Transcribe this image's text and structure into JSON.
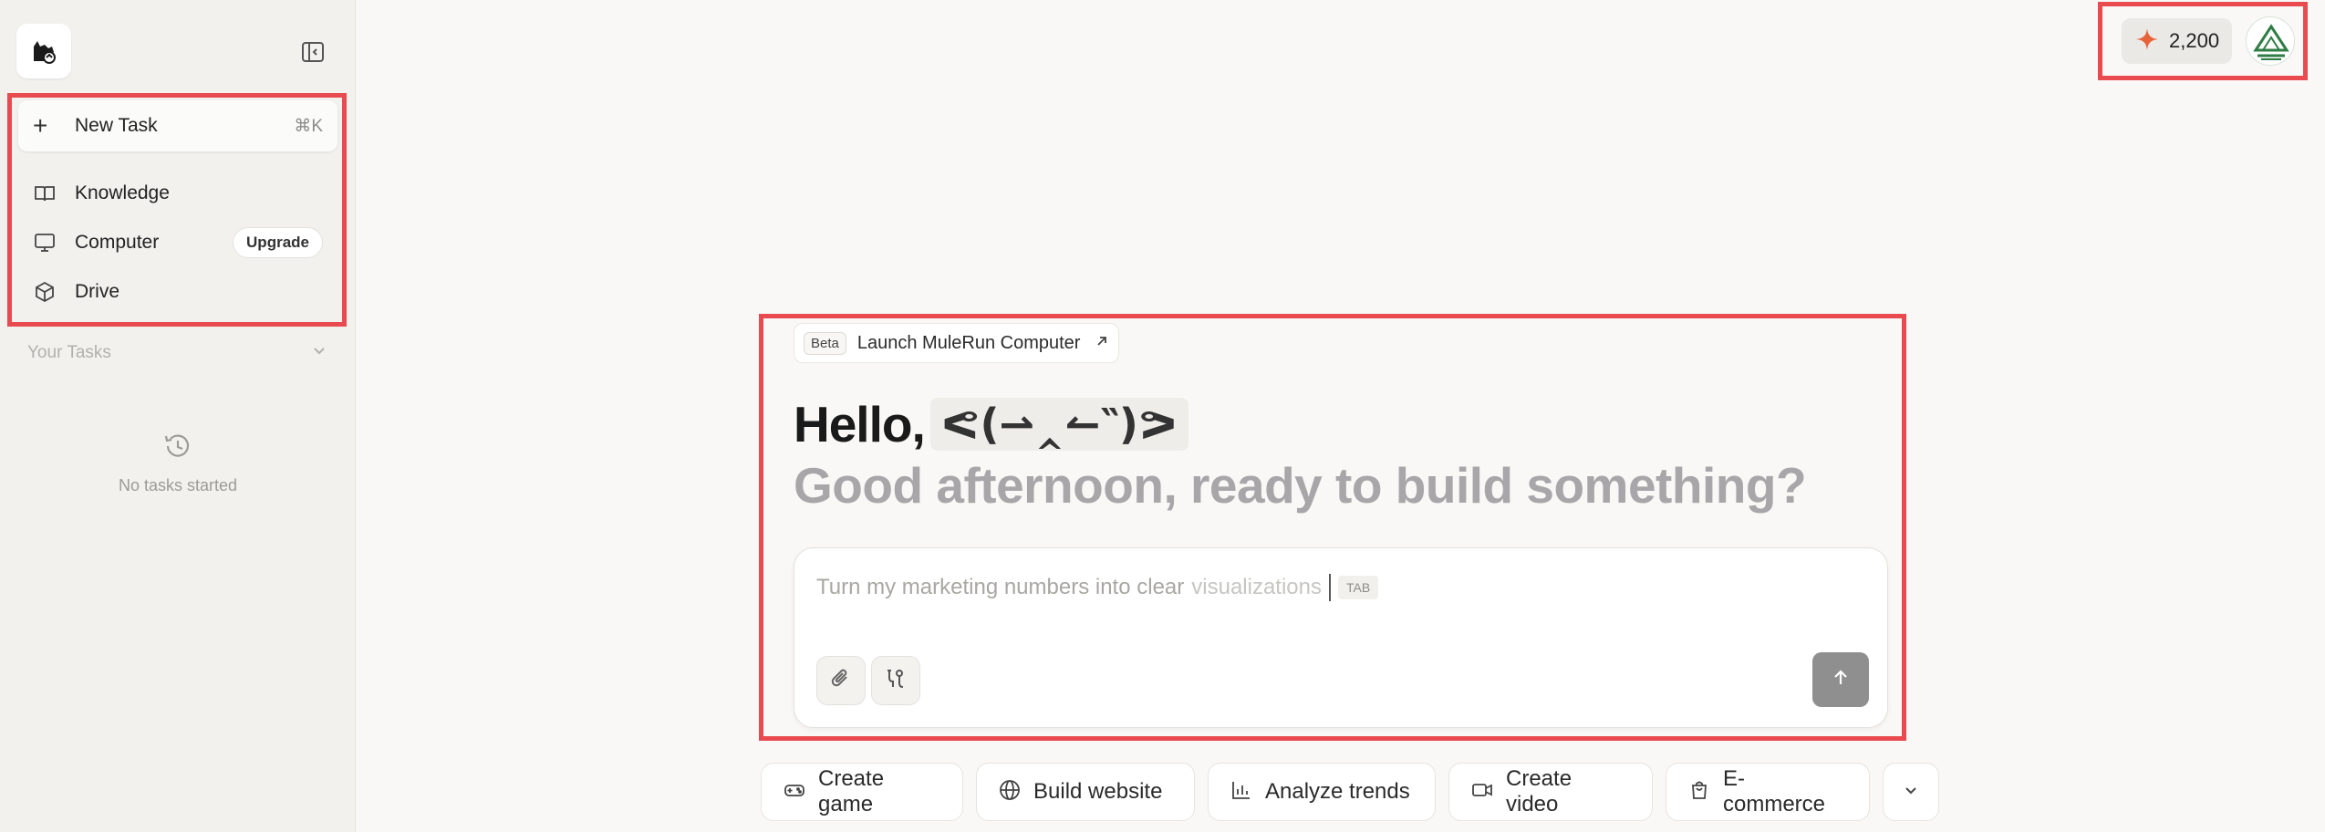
{
  "sidebar": {
    "logo_icon": "mule-logo-icon",
    "collapse_icon": "sidebar-collapse-icon",
    "new_task": {
      "label": "New Task",
      "shortcut": "⌘K"
    },
    "items": [
      {
        "label": "Knowledge",
        "icon": "book-icon"
      },
      {
        "label": "Computer",
        "icon": "monitor-icon",
        "badge": "Upgrade"
      },
      {
        "label": "Drive",
        "icon": "box-icon"
      }
    ],
    "your_tasks_label": "Your Tasks",
    "empty_state": "No tasks started"
  },
  "header": {
    "credits": "2,200",
    "credits_icon": "sparkle-icon",
    "accent": "#e8633a"
  },
  "main": {
    "beta_tag": "Beta",
    "launch_label": "Launch MuleRun Computer",
    "hello": "Hello,",
    "user_name": "ᕙ(⇀‸↼‶)ᕗ",
    "greeting": "Good afternoon, ready to build something?",
    "input": {
      "placeholder_main": "Turn my marketing numbers into clear",
      "placeholder_faded": "visualizations",
      "tab_hint": "TAB"
    },
    "chips": [
      {
        "label": "Create game",
        "icon": "gamepad-icon"
      },
      {
        "label": "Build website",
        "icon": "globe-icon"
      },
      {
        "label": "Analyze trends",
        "icon": "bar-chart-icon"
      },
      {
        "label": "Create video",
        "icon": "video-icon"
      },
      {
        "label": "E-commerce",
        "icon": "shopping-bag-icon"
      }
    ]
  },
  "highlight_color": "#e84a50"
}
